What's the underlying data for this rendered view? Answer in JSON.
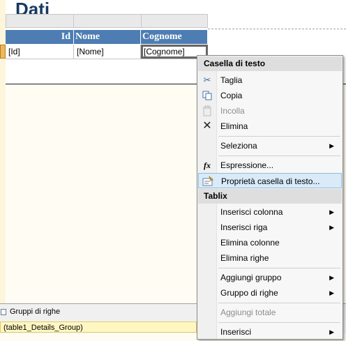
{
  "report": {
    "title_partial": "Dati",
    "headers": [
      "Id",
      "Nome",
      "Cognome"
    ],
    "row": [
      "[Id]",
      "[Nome]",
      "[Cognome]"
    ]
  },
  "group_pane": {
    "label": "Gruppi di righe",
    "item": "(table1_Details_Group)"
  },
  "context_menu": {
    "sections": [
      {
        "header": "Casella di testo",
        "items": [
          {
            "label": "Taglia",
            "icon": "scissors-icon",
            "disabled": false
          },
          {
            "label": "Copia",
            "icon": "copy-icon",
            "disabled": false
          },
          {
            "label": "Incolla",
            "icon": "paste-icon",
            "disabled": true
          },
          {
            "label": "Elimina",
            "icon": "delete-x-icon",
            "disabled": false
          },
          {
            "label": "Seleziona",
            "submenu": true
          },
          {
            "label": "Espressione...",
            "icon": "fx-icon"
          },
          {
            "label": "Proprietà casella di testo...",
            "icon": "properties-icon",
            "highlighted": true
          }
        ]
      },
      {
        "header": "Tablix",
        "items": [
          {
            "label": "Inserisci colonna",
            "submenu": true
          },
          {
            "label": "Inserisci riga",
            "submenu": true
          },
          {
            "label": "Elimina colonne"
          },
          {
            "label": "Elimina righe"
          },
          {
            "label": "Aggiungi gruppo",
            "submenu": true
          },
          {
            "label": "Gruppo di righe",
            "submenu": true
          },
          {
            "label": "Aggiungi totale",
            "disabled": true
          },
          {
            "label": "Inserisci",
            "submenu": true
          }
        ]
      }
    ]
  },
  "colors": {
    "header_blue": "#4d7db2",
    "highlight": "#d9ebf8",
    "title": "#17395f"
  }
}
